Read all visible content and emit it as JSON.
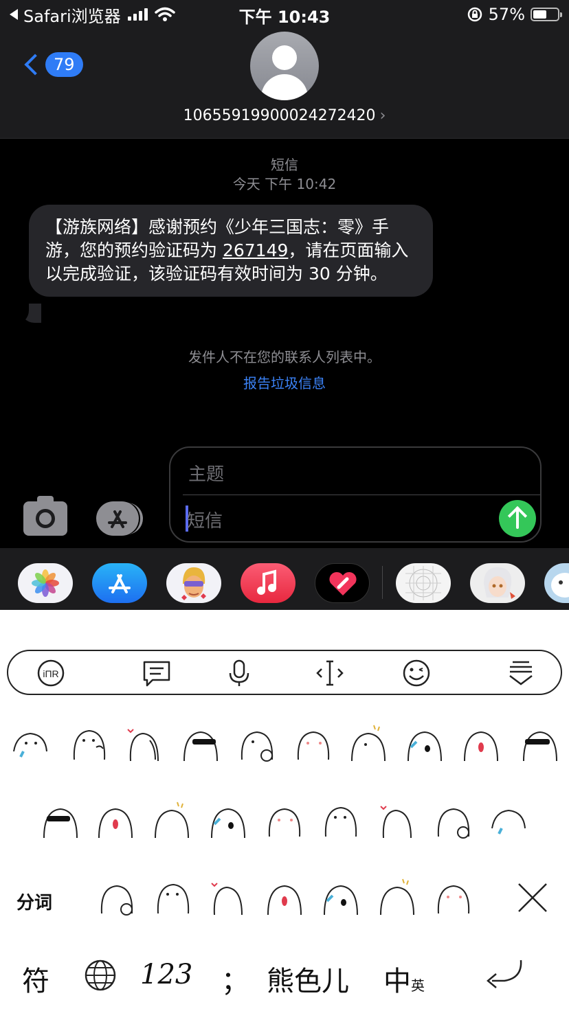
{
  "status_bar": {
    "back_app": "Safari浏览器",
    "time": "下午 10:43",
    "battery": "57%",
    "battery_level": 0.57
  },
  "header": {
    "back_badge": "79",
    "contact": "10655919900024272420",
    "contact_chevron": "›"
  },
  "conversation": {
    "type_label": "短信",
    "timestamp": "今天 下午 10:42",
    "message_pre": "【游族网络】感谢预约《少年三国志：零》手游，您的预约验证码为 ",
    "message_code": "267149",
    "message_post": "，请在页面输入以完成验证，该验证码有效时间为 30 分钟。",
    "notice": "发件人不在您的联系人列表中。",
    "report_link": "报告垃圾信息"
  },
  "composer": {
    "subject_placeholder": "主题",
    "message_placeholder": "短信"
  },
  "app_strip": {
    "apps": [
      "photos-icon",
      "app-store-icon",
      "memoji-icon",
      "music-icon",
      "digital-touch-icon",
      "sticker-grid-icon",
      "anime-sticker-icon",
      "cow-sticker-icon"
    ]
  },
  "keyboard": {
    "toolbar": [
      "ime-logo-icon",
      "message-icon",
      "microphone-icon",
      "cursor-icon",
      "emoji-icon",
      "keyboard-collapse-icon"
    ],
    "fenci_label": "分词",
    "keys": {
      "symbols": "符",
      "numbers": "123",
      "punct": "；",
      "sticker": "熊色儿",
      "lang_main": "中",
      "lang_sub": "英"
    }
  }
}
